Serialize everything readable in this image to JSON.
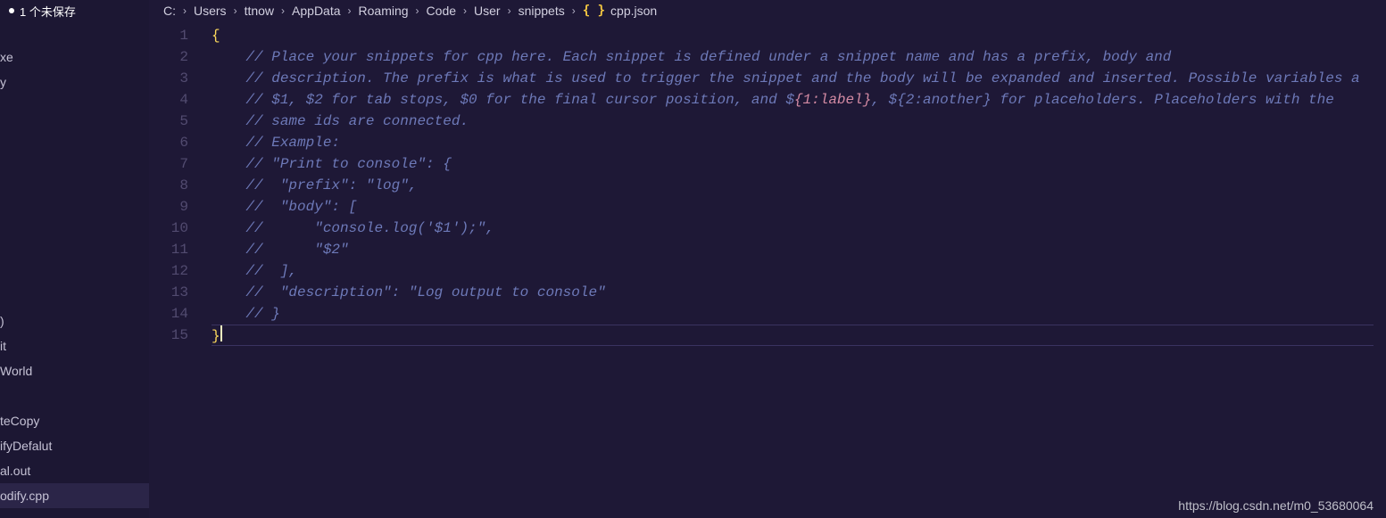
{
  "sidebar": {
    "unsaved_label": "1 个未保存",
    "files": [
      "xe",
      "y",
      ")",
      "it",
      "World",
      "",
      "teCopy",
      "ifyDefalut",
      "al.out",
      "odify.cpp"
    ],
    "active_index": 9
  },
  "breadcrumb": {
    "segments": [
      "C:",
      "Users",
      "ttnow",
      "AppData",
      "Roaming",
      "Code",
      "User",
      "snippets"
    ],
    "file_icon": "{ }",
    "file": "cpp.json"
  },
  "code": {
    "line_count": 15,
    "open_brace": "{",
    "close_brace": "}",
    "comment_prefix": "// ",
    "indent": "    ",
    "c1": "Place your snippets for cpp here. Each snippet is defined under a snippet name and has a prefix, body and",
    "c2": "description. The prefix is what is used to trigger the snippet and the body will be expanded and inserted. Possible variables a",
    "c3a": "$1, $2 for tab stops, $0 for the final cursor position, and $",
    "c3_h1": "{1:label}",
    "c3b": ", $",
    "c3_h2": "{2:another}",
    "c3c": " for placeholders. Placeholders with the",
    "c4": "same ids are connected.",
    "c5": "Example:",
    "c6": "\"Print to console\": {",
    "c7": " \"prefix\": \"log\",",
    "c8": " \"body\": [",
    "c9": "     \"console.log('$1');\",",
    "c10": "     \"$2\"",
    "c11": " ],",
    "c12": " \"description\": \"Log output to console\"",
    "c13": "}"
  },
  "watermark": "https://blog.csdn.net/m0_53680064"
}
